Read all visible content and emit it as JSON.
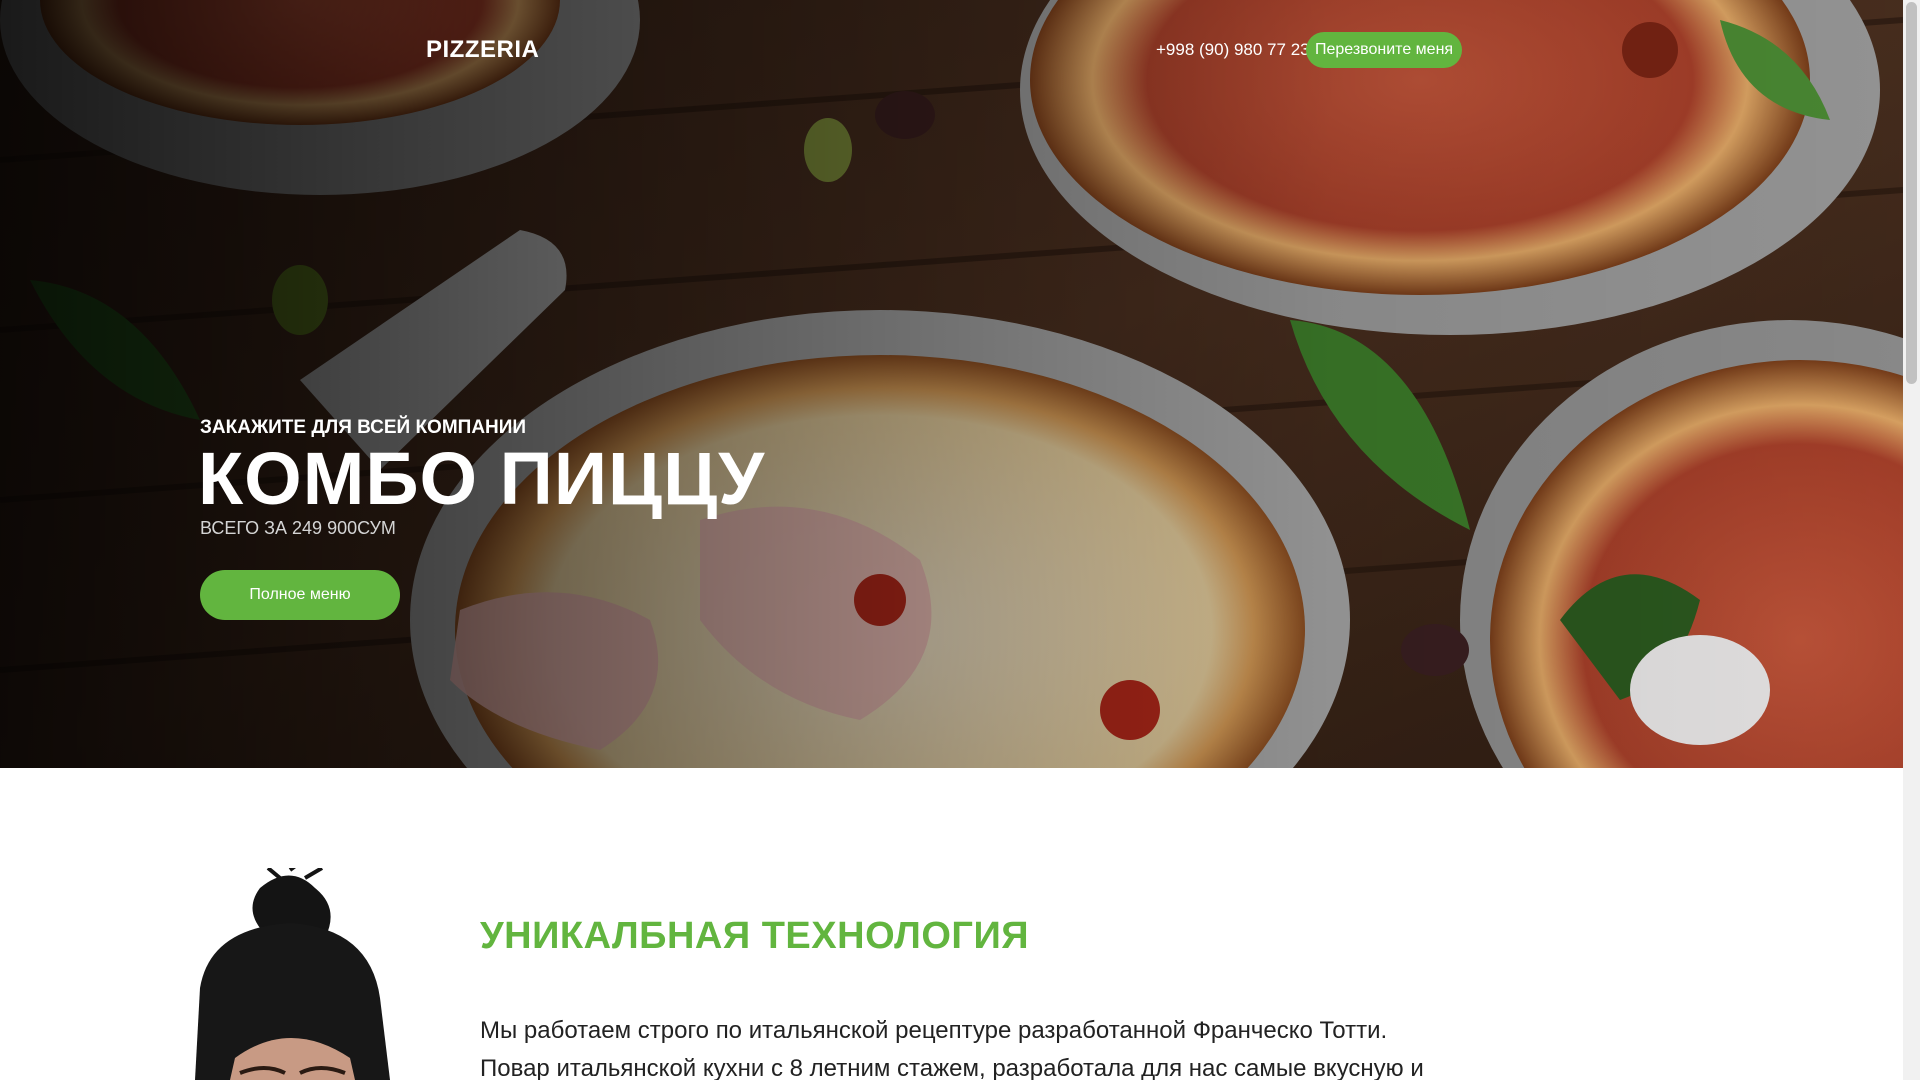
{
  "header": {
    "logo": "PIZZERIA",
    "phone": "+998 (90) 980 77 23",
    "callback_label": "Перезвоните меня"
  },
  "hero": {
    "subtitle": "ЗАКАЖИТЕ ДЛЯ ВСЕЙ КОМПАНИИ",
    "title": "КОМБО ПИЦЦУ",
    "price": "ВСЕГО ЗА 249 900СУМ",
    "menu_button": "Полное меню"
  },
  "about": {
    "title": "УНИКАЛБНАЯ ТЕХНОЛОГИЯ",
    "text": "Мы работаем строго по итальянской рецептуре разработанной Франческо Тотти. Повар итальянской кухни с 8 летним стажем, разработала для нас самые вкусную и"
  },
  "colors": {
    "accent": "#62b53f",
    "hero_text": "#ffffff",
    "body_text": "#222222"
  }
}
